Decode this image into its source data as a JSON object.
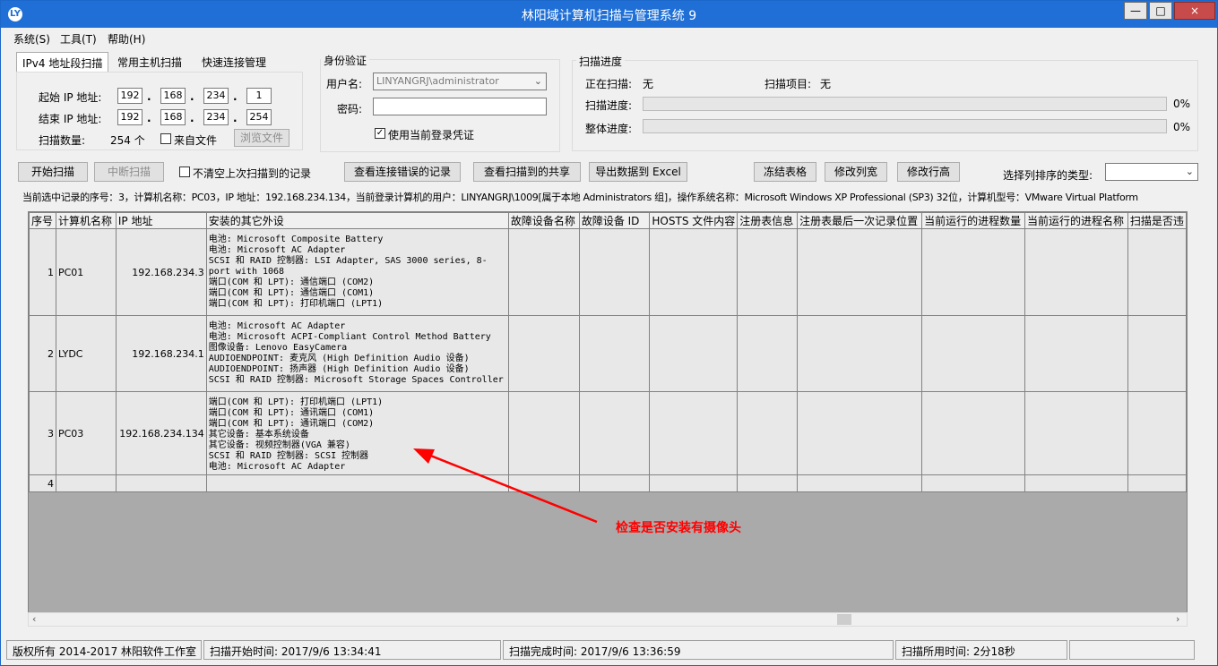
{
  "window": {
    "title": "林阳域计算机扫描与管理系统 9",
    "app_icon": "LY",
    "minimize": "—",
    "maximize": "□",
    "close": "×"
  },
  "menu": [
    "系统(S)",
    "工具(T)",
    "帮助(H)"
  ],
  "tabs": [
    "IPv4 地址段扫描",
    "常用主机扫描",
    "快速连接管理"
  ],
  "range": {
    "start_label": "起始 IP 地址:",
    "start": [
      "192",
      "168",
      "234",
      "1"
    ],
    "end_label": "结束 IP 地址:",
    "end": [
      "192",
      "168",
      "234",
      "254"
    ],
    "count_label": "扫描数量:",
    "count": "254 个",
    "from_file_label": "来自文件",
    "browse_label": "浏览文件"
  },
  "auth": {
    "title": "身份验证",
    "user_label": "用户名:",
    "user_value": "LINYANGRJ\\administrator",
    "password_label": "密码:",
    "use_current_label": "使用当前登录凭证",
    "use_current_checked": true
  },
  "progress": {
    "title": "扫描进度",
    "scanning_label": "正在扫描:",
    "scanning_value": "无",
    "item_label": "扫描项目:",
    "item_value": "无",
    "scan_label": "扫描进度:",
    "scan_pct": "0%",
    "overall_label": "整体进度:",
    "overall_pct": "0%"
  },
  "toolbar": {
    "start": "开始扫描",
    "stop": "中断扫描",
    "keep_label": "不清空上次扫描到的记录",
    "errors": "查看连接错误的记录",
    "shares": "查看扫描到的共享",
    "export": "导出数据到 Excel",
    "freeze": "冻结表格",
    "col_width": "修改列宽",
    "row_height": "修改行高",
    "sort_label": "选择列排序的类型:"
  },
  "info_line": "当前选中记录的序号：3，计算机名称：PC03，IP 地址：192.168.234.134，当前登录计算机的用户：LINYANGRJ\\1009[属于本地 Administrators 组]，操作系统名称：Microsoft Windows XP Professional (SP3) 32位，计算机型号：VMware Virtual Platform",
  "table": {
    "headers": [
      "序号",
      "计算机名称",
      "IP 地址",
      "安装的其它外设",
      "故障设备名称",
      "故障设备 ID",
      "HOSTS 文件内容",
      "注册表信息",
      "注册表最后一次记录位置",
      "当前运行的进程数量",
      "当前运行的进程名称",
      "扫描是否违"
    ],
    "rows": [
      {
        "no": "1",
        "name": "PC01",
        "ip": "192.168.234.3",
        "devices": "电池: Microsoft Composite Battery\n电池: Microsoft AC Adapter\nSCSI 和 RAID 控制器: LSI Adapter, SAS 3000 series, 8-port with 1068\n端口(COM 和 LPT): 通信端口 (COM2)\n端口(COM 和 LPT): 通信端口 (COM1)\n端口(COM 和 LPT): 打印机端口 (LPT1)"
      },
      {
        "no": "2",
        "name": "LYDC",
        "ip": "192.168.234.1",
        "devices": "电池: Microsoft AC Adapter\n电池: Microsoft ACPI-Compliant Control Method Battery\n图像设备: Lenovo EasyCamera\nAUDIOENDPOINT: 麦克风 (High Definition Audio 设备)\nAUDIOENDPOINT: 扬声器 (High Definition Audio 设备)\nSCSI 和 RAID 控制器: Microsoft Storage Spaces Controller"
      },
      {
        "no": "3",
        "name": "PC03",
        "ip": "192.168.234.134",
        "devices": "端口(COM 和 LPT): 打印机端口 (LPT1)\n端口(COM 和 LPT): 通讯端口 (COM1)\n端口(COM 和 LPT): 通讯端口 (COM2)\n其它设备: 基本系统设备\n其它设备: 视频控制器(VGA 兼容)\nSCSI 和 RAID 控制器: SCSI 控制器\n电池: Microsoft AC Adapter"
      },
      {
        "no": "4",
        "name": "",
        "ip": "",
        "devices": ""
      }
    ]
  },
  "annotation": "检查是否安装有摄像头",
  "status": {
    "copyright": "版权所有 2014-2017 林阳软件工作室",
    "start": "扫描开始时间: 2017/9/6 13:34:41",
    "end": "扫描完成时间: 2017/9/6 13:36:59",
    "elapsed": "扫描所用时间: 2分18秒"
  },
  "colors": {
    "titlebar": "#1f6fd6",
    "annotation": "#ff0000"
  }
}
